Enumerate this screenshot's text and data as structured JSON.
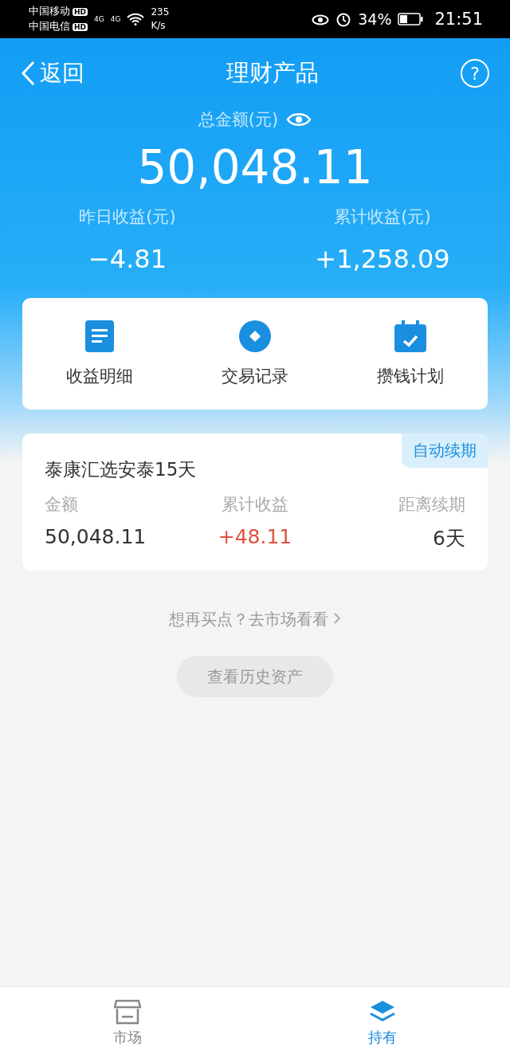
{
  "status_bar": {
    "carriers": [
      "中国移动",
      "中国电信"
    ],
    "hd": [
      "HD",
      "HD"
    ],
    "network": [
      "4G",
      "4G"
    ],
    "speed": "235",
    "speed_unit": "K/s",
    "battery": "34%",
    "time": "21:51"
  },
  "nav": {
    "back": "返回",
    "title": "理财产品",
    "help": "?"
  },
  "summary": {
    "total_label": "总金额(元)",
    "total": "50,048.11",
    "yesterday_label": "昨日收益(元)",
    "yesterday": "−4.81",
    "cumulative_label": "累计收益(元)",
    "cumulative": "+1,258.09"
  },
  "shortcuts": [
    {
      "kind": "document",
      "label": "收益明细"
    },
    {
      "kind": "record",
      "label": "交易记录"
    },
    {
      "kind": "calendar",
      "label": "攒钱计划"
    }
  ],
  "holding": {
    "name": "泰康汇选安泰15天",
    "badge": "自动续期",
    "columns": [
      {
        "label": "金额",
        "value": "50,048.11",
        "color": "#333333"
      },
      {
        "label": "累计收益",
        "value": "+48.11",
        "color": "#e0513f"
      },
      {
        "label": "距离续期",
        "value": "6天",
        "color": "#333333"
      }
    ]
  },
  "market_link": "想再买点？去市场看看",
  "history_button": "查看历史资产",
  "tab_bar": [
    {
      "kind": "market",
      "label": "市场",
      "selected": false
    },
    {
      "kind": "holdings",
      "label": "持有",
      "selected": true
    }
  ]
}
